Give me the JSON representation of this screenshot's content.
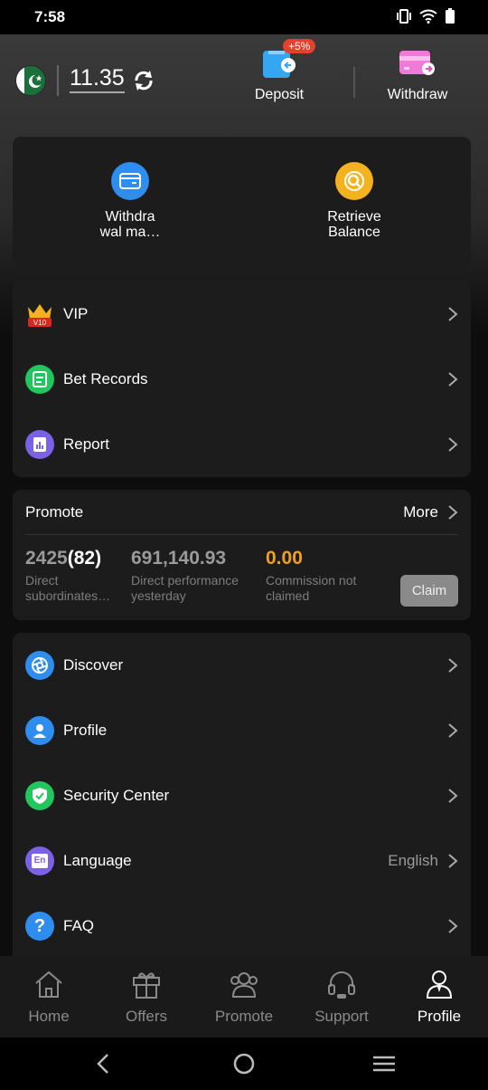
{
  "status": {
    "time": "7:58"
  },
  "header": {
    "balance": "11.35",
    "deposit_label": "Deposit",
    "deposit_badge": "+5%",
    "withdraw_label": "Withdraw"
  },
  "quick": [
    {
      "label_line1": "Withdra",
      "label_line2": "wal ma…"
    },
    {
      "label_line1": "Retrieve",
      "label_line2": "Balance"
    }
  ],
  "menu1": [
    {
      "label": "VIP",
      "icon": "vip-crown-icon",
      "badge": "V10"
    },
    {
      "label": "Bet Records",
      "icon": "bet-records-icon"
    },
    {
      "label": "Report",
      "icon": "report-icon"
    }
  ],
  "promote": {
    "title": "Promote",
    "more": "More",
    "stat1_value": "2425",
    "stat1_paren": "(82)",
    "stat1_cap1": "Direct",
    "stat1_cap2": "subordinates…",
    "stat2_value": "691,140.93",
    "stat2_cap1": "Direct performance",
    "stat2_cap2": "yesterday",
    "stat3_value": "0.00",
    "stat3_cap1": "Commission not",
    "stat3_cap2": "claimed",
    "claim": "Claim"
  },
  "menu2": [
    {
      "label": "Discover",
      "icon": "discover-icon"
    },
    {
      "label": "Profile",
      "icon": "profile-icon"
    },
    {
      "label": "Security Center",
      "icon": "shield-icon"
    },
    {
      "label": "Language",
      "icon": "language-icon",
      "value": "English",
      "icon_text": "En"
    },
    {
      "label": "FAQ",
      "icon": "faq-icon",
      "icon_text": "?"
    }
  ],
  "nav": [
    {
      "label": "Home"
    },
    {
      "label": "Offers"
    },
    {
      "label": "Promote"
    },
    {
      "label": "Support"
    },
    {
      "label": "Profile"
    }
  ],
  "colors": {
    "accent_orange": "#f0a020",
    "card_bg": "#1c1c1c",
    "claim_bg": "#8a8a8a"
  }
}
